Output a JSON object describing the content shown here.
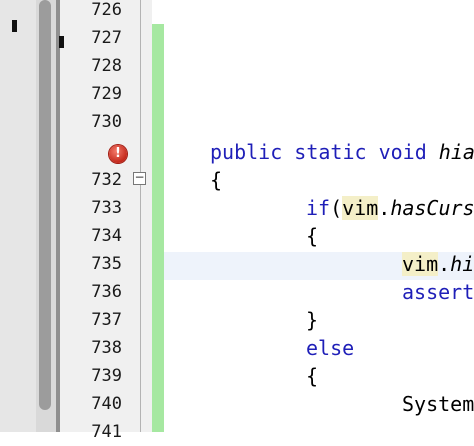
{
  "line_numbers": [
    "726",
    "727",
    "728",
    "729",
    "730",
    "732",
    "733",
    "734",
    "735",
    "736",
    "737",
    "738",
    "739",
    "740",
    "741"
  ],
  "error_icon": {
    "name": "error-icon",
    "glyph": "!"
  },
  "fold_glyph": "−",
  "code": {
    "l731_kw": "public static void ",
    "l731_method": "hia",
    "l732_brace": "{",
    "l733_kw": "if",
    "l733_paren": "(",
    "l733_obj": "vim",
    "l733_dot": ".",
    "l733_method": "hasCurs",
    "l734_brace": "{",
    "l735_obj": "vim",
    "l735_dot": ".",
    "l735_method": "hi",
    "l736_text": "assert",
    "l737_brace": "}",
    "l738_kw": "else",
    "l739_brace": "{",
    "l740_text": "System"
  },
  "colors": {
    "keyword": "#1f1fb8",
    "change_bar": "#a6e8a1",
    "identifier_highlight": "#f4efc8",
    "current_line": "#eef3fb"
  }
}
